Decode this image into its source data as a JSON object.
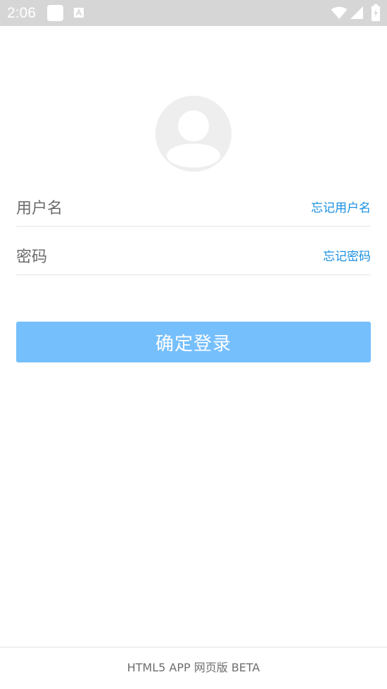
{
  "status_bar": {
    "time": "2:06",
    "icons": [
      "notification-square-icon",
      "notification-a-icon",
      "wifi-icon",
      "cell-signal-icon",
      "battery-charging-icon"
    ],
    "background": "#d6d6d6"
  },
  "avatar": {
    "icon": "user-avatar-icon",
    "color": "#eeeeee"
  },
  "login_form": {
    "username": {
      "value": "",
      "placeholder": "用户名",
      "forgot_label": "忘记用户名"
    },
    "password": {
      "value": "",
      "placeholder": "密码",
      "forgot_label": "忘记密码"
    },
    "submit_label": "确定登录"
  },
  "footer": {
    "text": "HTML5 APP 网页版 BETA"
  },
  "colors": {
    "accent": "#1a8fe0",
    "button": "#76bffd",
    "divider": "#e6e6e6"
  }
}
